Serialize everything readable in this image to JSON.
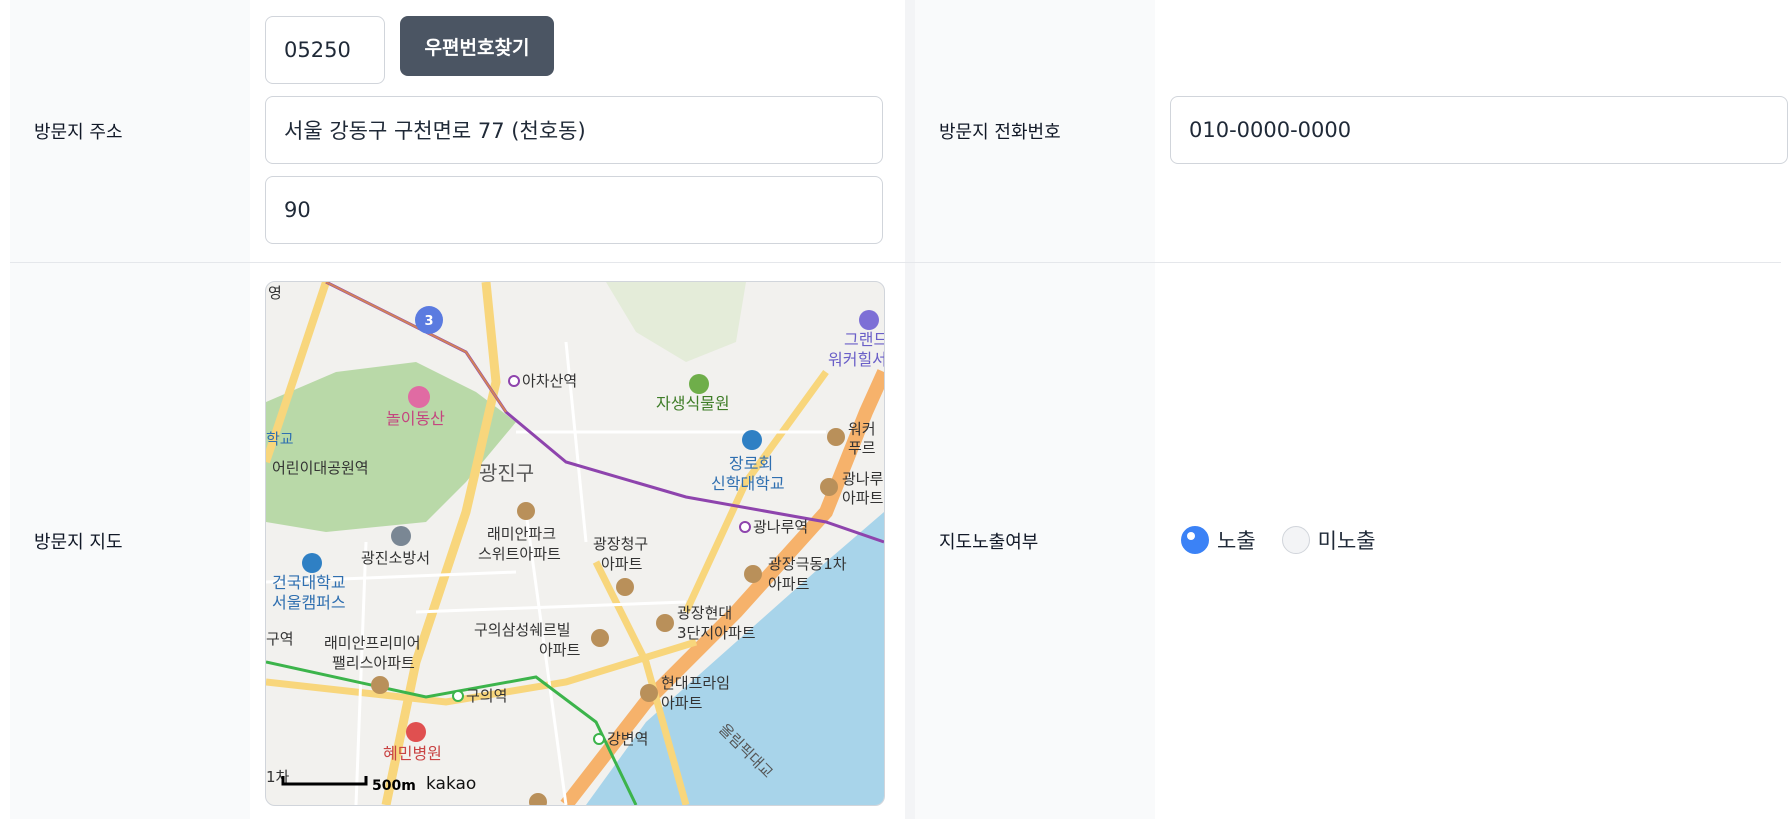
{
  "address": {
    "label": "방문지 주소",
    "zipcode": "05250",
    "zip_button": "우편번호찾기",
    "road_address": "서울 강동구 구천면로 77 (천호동)",
    "detail_address": "90"
  },
  "phone": {
    "label": "방문지 전화번호",
    "value": "010-0000-0000"
  },
  "map": {
    "label": "방문지 지도",
    "places": {
      "district": "광진구",
      "park": "놀이동산",
      "childrens_park": "어린이대공원역",
      "achasan": "아차산역",
      "gwangnaru": "광나루역",
      "guui": "구의역",
      "gangbyeon": "강변역",
      "fire_station": "광진소방서",
      "konkuk1": "건국대학교",
      "konkuk2": "서울캠퍼스",
      "jangrohoe1": "장로회",
      "jangrohoe2": "신학대학교",
      "botanical": "자생식물원",
      "raemian_park1": "래미안파크",
      "raemian_park2": "스위트아파트",
      "gwangjang_cheonggu1": "광장청구",
      "gwangjang_cheonggu2": "아파트",
      "gwangjang_geukdong1": "광장극동1차",
      "gwangjang_geukdong2": "아파트",
      "guui_samsung1": "구의삼성쉐르빌",
      "guui_samsung2": "아파트",
      "gwangjang_hyundai1": "광장현대",
      "gwangjang_hyundai2": "3단지아파트",
      "raemian_premier1": "래미안프리미어",
      "raemian_premier2": "팰리스아파트",
      "hyundai_prime1": "현대프라임",
      "hyundai_prime2": "아파트",
      "hyemin": "혜민병원",
      "bridge": "올림픽대교",
      "grand1": "그랜드",
      "grand2": "워커힐서",
      "walker1": "워커",
      "walker2": "푸르",
      "gwangnaru_apt1": "광나루",
      "gwangnaru_apt2": "아파트",
      "edge_young": "영",
      "edge_school": "학교",
      "edge_station": "구역",
      "edge_1cha": "1차",
      "line_badge": "3"
    },
    "scale": "500m",
    "logo": "kakao"
  },
  "map_display": {
    "label": "지도노출여부",
    "options": [
      {
        "label": "노출",
        "checked": true
      },
      {
        "label": "미노출",
        "checked": false
      }
    ]
  }
}
